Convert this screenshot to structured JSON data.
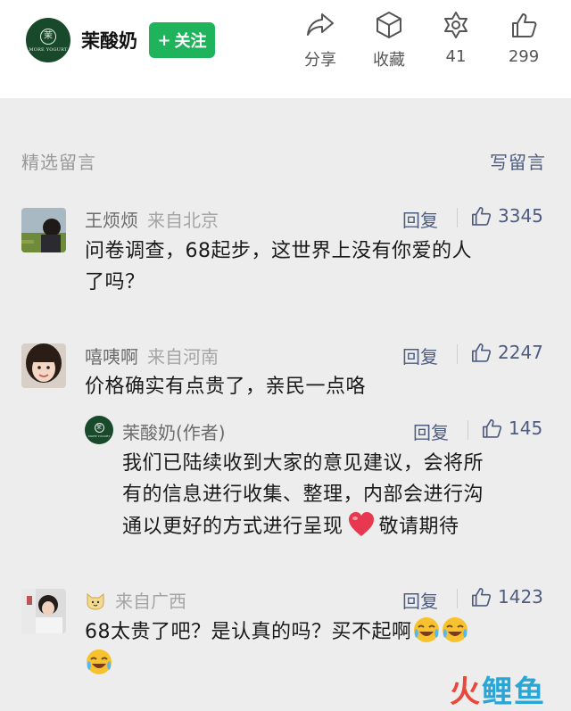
{
  "header": {
    "account_name": "茉酸奶",
    "logo_text": "MORE YOGURT",
    "follow_plus": "+",
    "follow_label": "关注",
    "actions": {
      "share_label": "分享",
      "favorite_label": "收藏",
      "wow_count": "41",
      "like_count": "299"
    }
  },
  "section": {
    "title": "精选留言",
    "write_label": "写留言"
  },
  "comments": [
    {
      "name": "王烦烦",
      "location": "来自北京",
      "reply_label": "回复",
      "likes": "3345",
      "text_line1": "问卷调查，68起步，这世界上没有你爱的人",
      "text_line2": "了吗？"
    },
    {
      "name": "嘻咦啊",
      "location": "来自河南",
      "reply_label": "回复",
      "likes": "2247",
      "text_line1": "价格确实有点贵了，亲民一点咯",
      "author_reply": {
        "name": "茉酸奶(作者)",
        "reply_label": "回复",
        "likes": "145",
        "text_line1": "我们已陆续收到大家的意见建议，会将所",
        "text_line2": "有的信息进行收集、整理，内部会进行沟",
        "text_line3": "通以更好的方式进行呈现",
        "text_line3_end": "敬请期待"
      }
    },
    {
      "name": "",
      "location": "来自广西",
      "reply_label": "回复",
      "likes": "1423",
      "text_line1": "68太贵了吧？是认真的吗？买不起啊"
    }
  ],
  "watermark": {
    "part1": "火",
    "part2": "鲤鱼"
  },
  "colors": {
    "accent_green": "#1fb45b",
    "link_blue": "#4e5c80",
    "logo_green": "#17492a",
    "heart": "#e8384f"
  }
}
